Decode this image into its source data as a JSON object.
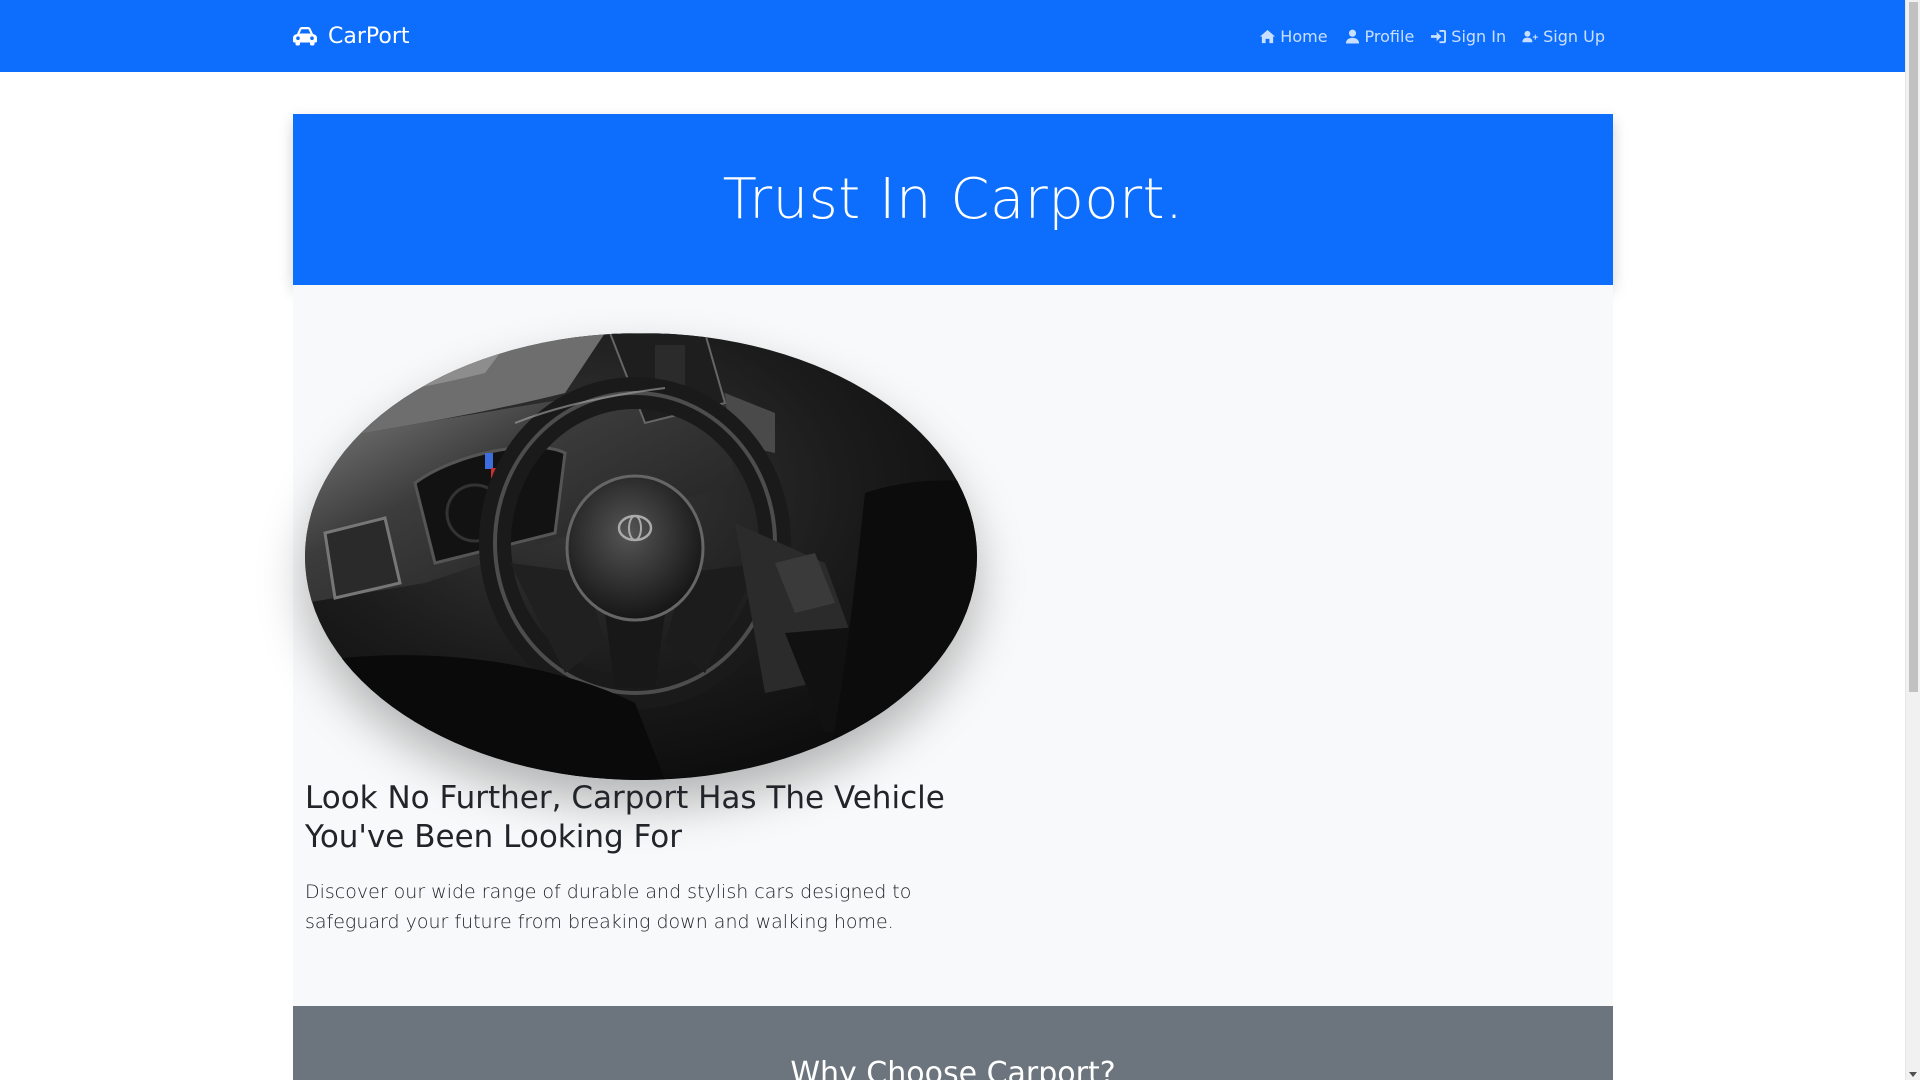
{
  "navbar": {
    "brand": "CarPort",
    "brand_icon": "car-icon",
    "links": [
      {
        "label": "Home",
        "icon": "home-icon"
      },
      {
        "label": "Profile",
        "icon": "user-icon"
      },
      {
        "label": "Sign In",
        "icon": "sign-in-icon"
      },
      {
        "label": "Sign Up",
        "icon": "user-plus-icon"
      }
    ]
  },
  "hero": {
    "title": "Trust In Carport."
  },
  "feature": {
    "image": "car-interior-photo",
    "headline": "Look No Further, Carport Has The Vehicle You've Been Looking For",
    "description": "Discover our wide range of durable and stylish cars designed to safeguard your future from breaking down and walking home."
  },
  "why": {
    "title": "Why Choose Carport?"
  },
  "colors": {
    "primary": "#0d6efd",
    "panel": "#f8f9fa",
    "secondary": "#6c757d"
  }
}
